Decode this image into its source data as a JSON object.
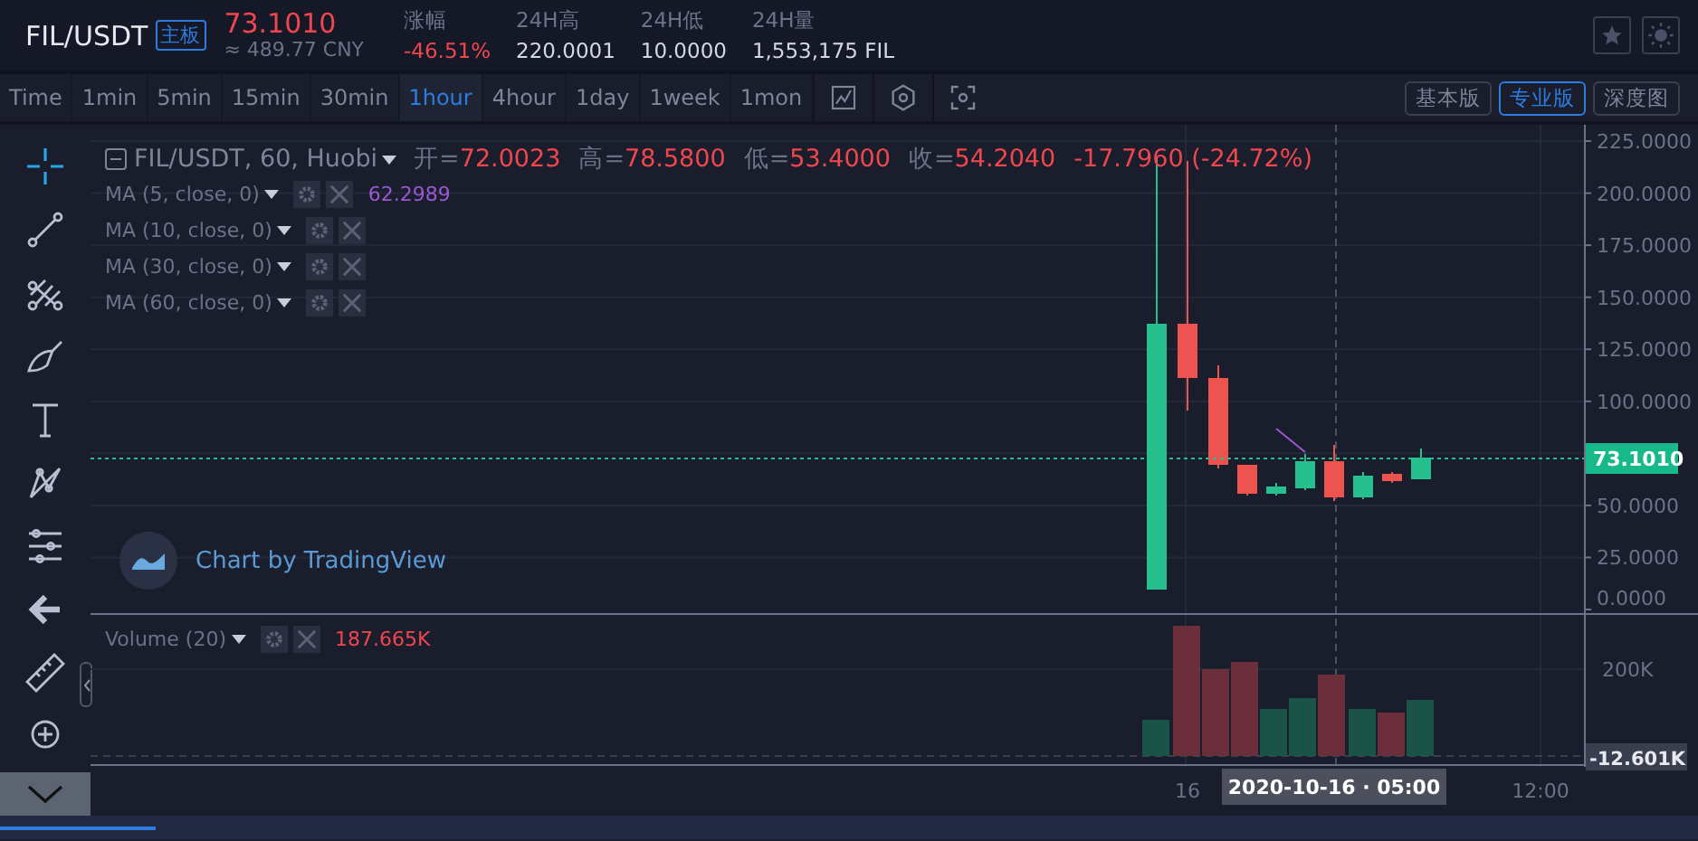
{
  "header": {
    "pair": "FIL/USDT",
    "board_tag": "主板",
    "price": "73.1010",
    "price_cny": "≈ 489.77 CNY",
    "stats": [
      {
        "label": "涨幅",
        "value": "-46.51%",
        "kind": "change"
      },
      {
        "label": "24H高",
        "value": "220.0001",
        "kind": "plain"
      },
      {
        "label": "24H低",
        "value": "10.0000",
        "kind": "plain"
      },
      {
        "label": "24H量",
        "value": "1,553,175 FIL",
        "kind": "plain"
      }
    ]
  },
  "intervals": [
    {
      "label": "Time",
      "selected": false
    },
    {
      "label": "1min",
      "selected": false
    },
    {
      "label": "5min",
      "selected": false
    },
    {
      "label": "15min",
      "selected": false
    },
    {
      "label": "30min",
      "selected": false
    },
    {
      "label": "1hour",
      "selected": true
    },
    {
      "label": "4hour",
      "selected": false
    },
    {
      "label": "1day",
      "selected": false
    },
    {
      "label": "1week",
      "selected": false
    },
    {
      "label": "1mon",
      "selected": false
    }
  ],
  "versions": [
    {
      "label": "基本版",
      "selected": false
    },
    {
      "label": "专业版",
      "selected": true
    },
    {
      "label": "深度图",
      "selected": false
    }
  ],
  "chart": {
    "symbol": "FIL/USDT, 60, Huobi",
    "ohlc": [
      {
        "label": "开=",
        "value": "72.0023"
      },
      {
        "label": "高=",
        "value": "78.5800"
      },
      {
        "label": "低=",
        "value": "53.4000"
      },
      {
        "label": "收=",
        "value": "54.2040"
      }
    ],
    "change": "-17.7960 (-24.72%)",
    "indicators": [
      {
        "name": "MA (5, close, 0)",
        "value": "62.2989"
      },
      {
        "name": "MA (10, close, 0)"
      },
      {
        "name": "MA (30, close, 0)"
      },
      {
        "name": "MA (60, close, 0)"
      }
    ],
    "branding": "Chart by TradingView",
    "price_ticks": [
      "225.0000",
      "200.0000",
      "175.0000",
      "150.0000",
      "125.0000",
      "100.0000",
      "50.0000",
      "25.0000",
      "0.0000"
    ],
    "last_price": "73.1010",
    "volume": {
      "name": "Volume (20)",
      "value": "187.665K",
      "tick": "200K",
      "min_label": "-12.601K"
    },
    "time_ticks": [
      "16",
      "12:00"
    ],
    "crosshair_time": "2020-10-16 · 05:00"
  }
}
